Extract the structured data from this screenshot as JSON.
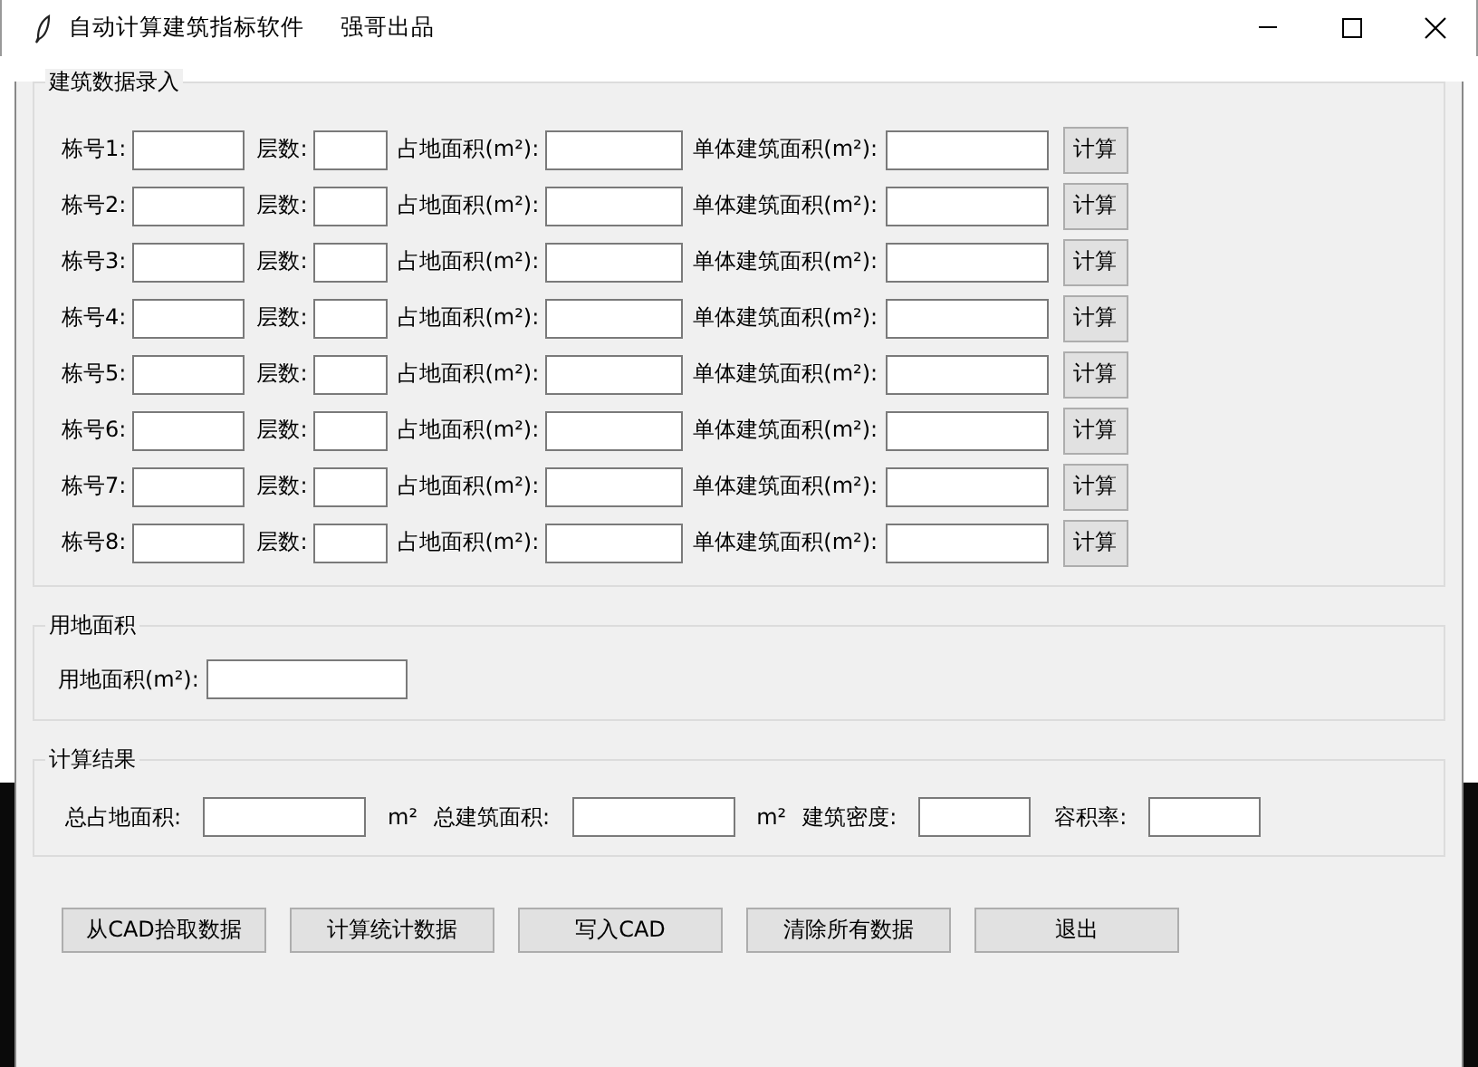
{
  "window": {
    "title": "自动计算建筑指标软件",
    "subtitle": "强哥出品"
  },
  "building_input": {
    "title": "建筑数据录入",
    "rows": [
      {
        "id_label": "栋号1:",
        "floors_label": "层数:",
        "footprint_label": "占地面积(m²):",
        "area_label": "单体建筑面积(m²):",
        "button": "计算"
      },
      {
        "id_label": "栋号2:",
        "floors_label": "层数:",
        "footprint_label": "占地面积(m²):",
        "area_label": "单体建筑面积(m²):",
        "button": "计算"
      },
      {
        "id_label": "栋号3:",
        "floors_label": "层数:",
        "footprint_label": "占地面积(m²):",
        "area_label": "单体建筑面积(m²):",
        "button": "计算"
      },
      {
        "id_label": "栋号4:",
        "floors_label": "层数:",
        "footprint_label": "占地面积(m²):",
        "area_label": "单体建筑面积(m²):",
        "button": "计算"
      },
      {
        "id_label": "栋号5:",
        "floors_label": "层数:",
        "footprint_label": "占地面积(m²):",
        "area_label": "单体建筑面积(m²):",
        "button": "计算"
      },
      {
        "id_label": "栋号6:",
        "floors_label": "层数:",
        "footprint_label": "占地面积(m²):",
        "area_label": "单体建筑面积(m²):",
        "button": "计算"
      },
      {
        "id_label": "栋号7:",
        "floors_label": "层数:",
        "footprint_label": "占地面积(m²):",
        "area_label": "单体建筑面积(m²):",
        "button": "计算"
      },
      {
        "id_label": "栋号8:",
        "floors_label": "层数:",
        "footprint_label": "占地面积(m²):",
        "area_label": "单体建筑面积(m²):",
        "button": "计算"
      }
    ]
  },
  "land_area": {
    "title": "用地面积",
    "label": "用地面积(m²):"
  },
  "results": {
    "title": "计算结果",
    "fields": [
      {
        "label": "总占地面积:",
        "unit": "m²"
      },
      {
        "label": "总建筑面积:",
        "unit": "m²"
      },
      {
        "label": "建筑密度:"
      },
      {
        "label": "容积率:"
      }
    ]
  },
  "buttons": [
    "从CAD拾取数据",
    "计算统计数据",
    "写入CAD",
    "清除所有数据",
    "退出"
  ]
}
